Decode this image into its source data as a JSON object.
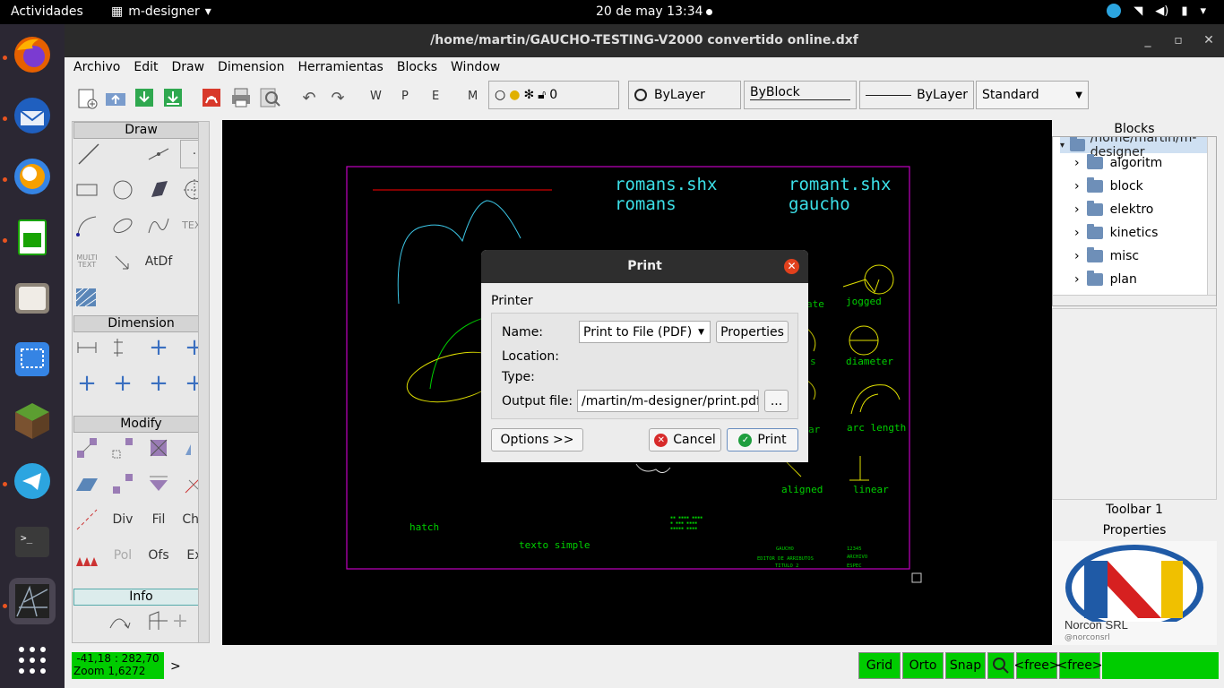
{
  "topbar": {
    "activities": "Actividades",
    "app_name": "m-designer",
    "clock": "20 de may  13:34"
  },
  "window": {
    "title": "/home/martin/GAUCHO-TESTING-V2000 convertido online.dxf"
  },
  "menu": [
    "Archivo",
    "Edit",
    "Draw",
    "Dimension",
    "Herramientas",
    "Blocks",
    "Window"
  ],
  "toolbar": {
    "letters": [
      "W",
      "P",
      "E",
      "M"
    ],
    "layer_value": "0",
    "color_combo": "ByLayer",
    "width_combo": "ByBlock",
    "linetype_combo": "ByLayer",
    "style_combo": "Standard"
  },
  "tool_panel": {
    "draw_header": "Draw",
    "dimension_header": "Dimension",
    "modify_header": "Modify",
    "info_header": "Info",
    "text_tool": "TEXT",
    "multi_text": "MULTI\nTEXT",
    "atdf": "AtDf",
    "div": "Div",
    "fil": "Fil",
    "cha": "Cha",
    "pol": "Pol",
    "ofs": "Ofs",
    "ex": "Ex"
  },
  "canvas": {
    "labels": {
      "romans_shx": "romans.shx",
      "romans": "romans",
      "romant_shx": "romant.shx",
      "gaucho": "gaucho",
      "jogged": "jogged",
      "diameter": "diameter",
      "arc_length": "arc length",
      "aligned": "aligned",
      "linear": "linear",
      "hatch": "hatch",
      "texto_simple": "texto simple",
      "ate": "ate",
      "s": "s",
      "ar": "ar",
      "gaucho_small": "GAUCHO",
      "editor": "EDITOR DE ARRIBUTOS",
      "titulo": "TITULO 2",
      "num": "12345",
      "archivo": "ARCHIVO",
      "espec": "ESPEC"
    }
  },
  "right_panel": {
    "blocks_title": "Blocks",
    "root": "/home/martin/m-designer",
    "folders": [
      "algoritm",
      "block",
      "elektro",
      "kinetics",
      "misc",
      "plan"
    ],
    "toolbar1": "Toolbar 1",
    "properties": "Properties",
    "company": "Norcon SRL",
    "handle": "@norconsrl"
  },
  "statusbar": {
    "coords": "-41,18 : 282,70",
    "zoom": "Zoom 1,6272",
    "prompt": ">",
    "grid": "Grid",
    "orto": "Orto",
    "snap": "Snap",
    "free1": "<free>",
    "free2": "<free>"
  },
  "dialog": {
    "title": "Print",
    "group": "Printer",
    "name_label": "Name:",
    "name_value": "Print to File (PDF)",
    "properties": "Properties",
    "location_label": "Location:",
    "type_label": "Type:",
    "output_label": "Output file:",
    "output_value": "/martin/m-designer/print.pdf",
    "browse": "...",
    "options": "Options >>",
    "cancel": "Cancel",
    "print": "Print"
  }
}
